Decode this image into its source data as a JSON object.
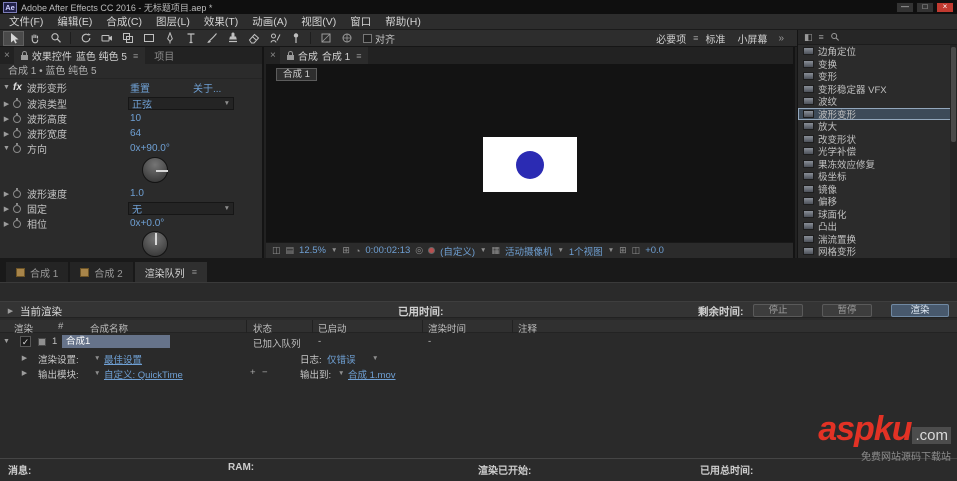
{
  "icons": {
    "menu": "≡",
    "twirl_open": "▼",
    "twirl_closed": "▶",
    "dropdown": "▼",
    "check": "✓",
    "overflow": "»",
    "add": "+",
    "remove": "−",
    "close": "×",
    "minimize": "—",
    "maximize": "□",
    "snapshot": "◫",
    "grid": "⊞",
    "region": "▤",
    "camera_glyph": "◎",
    "resolution": "▦",
    "mask_glyph": "◔",
    "panel_box": "◧"
  },
  "title_bar": {
    "app_badge": "Ae",
    "title": "Adobe After Effects CC 2016 - 无标题项目.aep *"
  },
  "menu_bar": {
    "items": [
      {
        "label": "文件(F)"
      },
      {
        "label": "编辑(E)"
      },
      {
        "label": "合成(C)"
      },
      {
        "label": "图层(L)"
      },
      {
        "label": "效果(T)"
      },
      {
        "label": "动画(A)"
      },
      {
        "label": "视图(V)"
      },
      {
        "label": "窗口"
      },
      {
        "label": "帮助(H)"
      }
    ]
  },
  "toolbar": {
    "snapping_label": "对齐",
    "workspaces": [
      {
        "label": "必要项"
      },
      {
        "label": "标准"
      },
      {
        "label": "小屏幕"
      }
    ]
  },
  "effect_controls": {
    "panel_title": "效果控件",
    "panel_target": "蓝色 纯色 5",
    "inactive_tab": "项目",
    "breadcrumb": "合成 1 • 蓝色 纯色 5",
    "fx_badge": "fx",
    "effect_name": "波形变形",
    "reset_label": "重置",
    "about_label": "关于...",
    "params": {
      "wave_type": {
        "label": "波浪类型",
        "value": "正弦"
      },
      "wave_height": {
        "label": "波形高度",
        "value": "10"
      },
      "wave_width": {
        "label": "波形宽度",
        "value": "64"
      },
      "direction": {
        "label": "方向",
        "value": "0x+90.0°"
      },
      "wave_speed": {
        "label": "波形速度",
        "value": "1.0"
      },
      "pinning": {
        "label": "固定",
        "value": "无"
      },
      "phase": {
        "label": "相位",
        "value": "0x+0.0°"
      }
    }
  },
  "composition_panel": {
    "panel_title": "合成",
    "panel_target": "合成 1",
    "viewer_tab": "合成 1",
    "footer": {
      "zoom": "12.5%",
      "timecode": "0:00:02:13",
      "channel": "(自定义)",
      "camera": "活动摄像机",
      "views": "1个视图",
      "exposure": "+0.0"
    }
  },
  "effects_presets": {
    "items": [
      {
        "label": "边角定位"
      },
      {
        "label": "变换"
      },
      {
        "label": "变形"
      },
      {
        "label": "变形稳定器 VFX"
      },
      {
        "label": "波纹"
      },
      {
        "label": "波形变形"
      },
      {
        "label": "放大"
      },
      {
        "label": "改变形状"
      },
      {
        "label": "光学补偿"
      },
      {
        "label": "果冻效应修复"
      },
      {
        "label": "极坐标"
      },
      {
        "label": "镜像"
      },
      {
        "label": "偏移"
      },
      {
        "label": "球面化"
      },
      {
        "label": "凸出"
      },
      {
        "label": "湍流置换"
      },
      {
        "label": "网格变形"
      }
    ]
  },
  "bottom_tabs": {
    "comp1": "合成 1",
    "comp2": "合成 2",
    "render_queue": "渲染队列"
  },
  "render_queue": {
    "current_render_label": "当前渲染",
    "elapsed_label": "已用时间:",
    "remaining_label": "剩余时间:",
    "stop_button": "停止",
    "pause_button": "暂停",
    "render_button": "渲染",
    "columns": {
      "render": "渲染",
      "number": "#",
      "comp_name": "合成名称",
      "status": "状态",
      "started": "已启动",
      "render_time": "渲染时间",
      "comment": "注释"
    },
    "row": {
      "number": "1",
      "name": "合成1",
      "status": "已加入队列",
      "started": "-",
      "render_time": "-"
    },
    "render_settings_label": "渲染设置:",
    "render_settings_value": "最佳设置",
    "log_label": "日志:",
    "log_value": "仅错误",
    "output_module_label": "输出模块:",
    "output_module_value": "自定义: QuickTime",
    "output_to_label": "输出到:",
    "output_to_value": "合成 1.mov"
  },
  "status_bar": {
    "message_label": "消息:",
    "ram_label": "RAM:",
    "render_started_label": "渲染已开始:",
    "total_time_label": "已用总时间:"
  },
  "watermark": {
    "brand": "aspku",
    "tld": ".com",
    "tagline": "免费网站源码下载站"
  },
  "colors": {
    "accent_blue": "#6fa0d4",
    "solid_fill": "#ffffff",
    "circle_fill": "#2b2bb3",
    "close_red": "#c13a30"
  }
}
